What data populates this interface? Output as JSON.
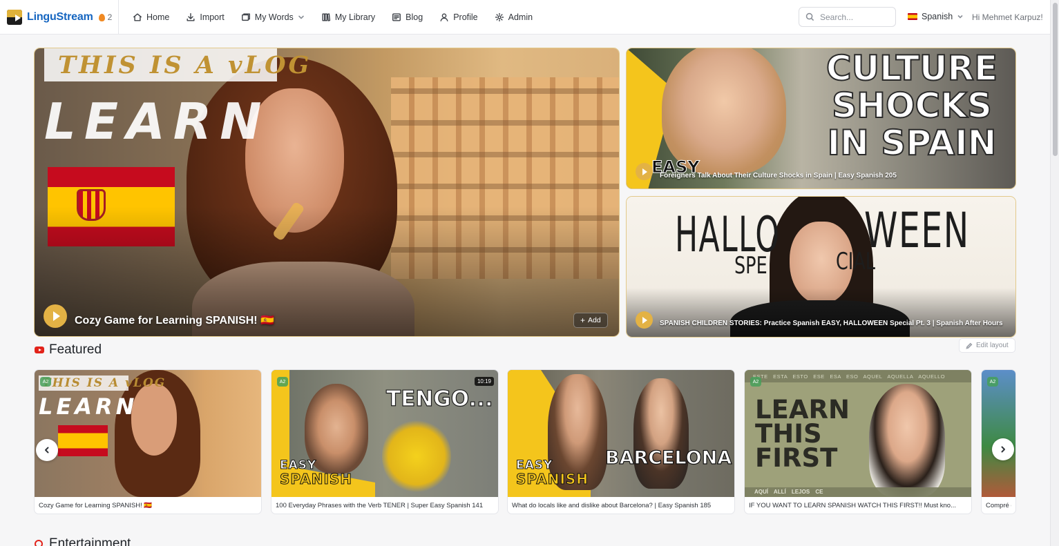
{
  "app": {
    "name": "LinguStream",
    "streak_count": "2"
  },
  "nav": {
    "items": [
      {
        "label": "Home",
        "icon": "home-icon"
      },
      {
        "label": "Import",
        "icon": "import-icon"
      },
      {
        "label": "My Words",
        "icon": "cards-icon",
        "has_dropdown": true
      },
      {
        "label": "My Library",
        "icon": "library-icon"
      },
      {
        "label": "Blog",
        "icon": "blog-icon"
      },
      {
        "label": "Profile",
        "icon": "profile-icon"
      },
      {
        "label": "Admin",
        "icon": "settings-icon"
      }
    ]
  },
  "search": {
    "placeholder": "Search...",
    "value": ""
  },
  "language": {
    "selected": "Spanish",
    "flag": "es-flag"
  },
  "user": {
    "greeting": "Hi Mehmet Karpuz!"
  },
  "hero": {
    "main": {
      "title": "Cozy Game for Learning SPANISH! 🇪🇸",
      "overlay_top": "THIS IS A vLOG",
      "overlay_big": "LEARN",
      "add_label": "Add"
    },
    "side": [
      {
        "title": "Foreigners Talk About Their Culture Shocks in Spain | Easy Spanish 205",
        "overlay": [
          "CULTURE",
          "SHOCKS",
          "IN SPAIN"
        ],
        "corner_text": "EASY"
      },
      {
        "title": "SPANISH CHILDREN STORIES: Practice Spanish EASY, HALLOWEEN Special Pt. 3 | Spanish After Hours",
        "overlay": [
          "HALLO",
          "WEEN",
          "SPE",
          "CIAL"
        ]
      }
    ]
  },
  "featured": {
    "heading": "Featured",
    "edit_layout_label": "Edit layout",
    "cards": [
      {
        "title": "Cozy Game for Learning SPANISH! 🇪🇸",
        "level": "A2",
        "overlay_top": "THIS IS A vLOG",
        "overlay_big": "LEARN"
      },
      {
        "title": "100 Everyday Phrases with the Verb TENER | Super Easy Spanish 141",
        "level": "A2",
        "duration": "10:19",
        "overlay": "TENGO...",
        "logo_top": "EASY",
        "logo_bottom": "SPANISH"
      },
      {
        "title": "What do locals like and dislike about Barcelona? | Easy Spanish 185",
        "overlay": "BARCELONA",
        "logo_top": "EASY",
        "logo_bottom": "SPANISH"
      },
      {
        "title": "IF YOU WANT TO LEARN SPANISH WATCH THIS FIRST!! Must kno...",
        "level": "A2",
        "overlay": [
          "LEARN",
          "THIS",
          "FIRST"
        ],
        "top_words": "ESTE ESTA ESTO ESE ESA ESO AQUEL AQUELLA AQUELLO",
        "bottom_words": "AQUÍ ALLÍ LEJOS CE"
      },
      {
        "title": "Compré e",
        "level": "A2"
      }
    ]
  },
  "entertainment": {
    "heading": "Entertainment"
  },
  "colors": {
    "brand_blue": "#1565c0",
    "accent_gold": "#e3b245",
    "youtube_red": "#e2231a",
    "easy_spanish_yellow": "#f4c51c"
  }
}
